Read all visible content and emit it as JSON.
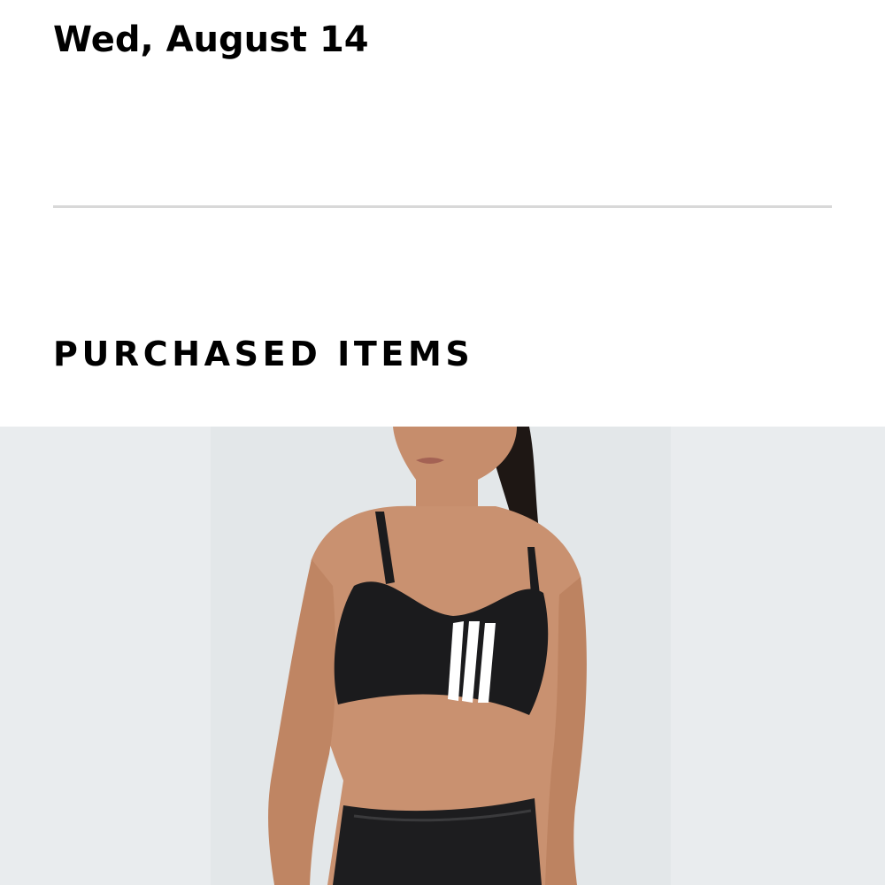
{
  "order": {
    "date": "Wed, August 14"
  },
  "purchased_items": {
    "heading": "PURCHASED ITEMS",
    "items": [
      {
        "image_icon": "product-photo-sports-bra",
        "image_background": "#eaedee",
        "garment_color": "#1b1b1d",
        "stripe_color": "#ffffff"
      }
    ]
  },
  "colors": {
    "text": "#000000",
    "divider": "#d8d8d8",
    "background": "#ffffff"
  }
}
